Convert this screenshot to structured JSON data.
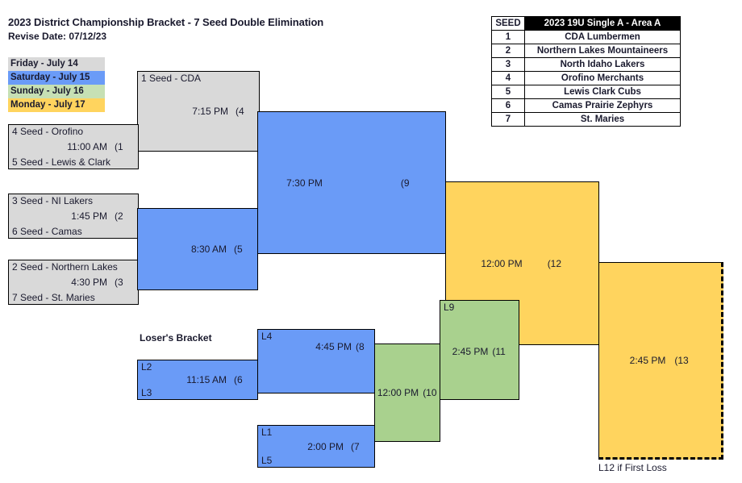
{
  "header": {
    "title": "2023 District Championship Bracket - 7 Seed Double Elimination",
    "revise_date": "Revise Date: 07/12/23"
  },
  "legend": {
    "items": [
      {
        "label": "Friday - July 14",
        "color": "#d9d9d9"
      },
      {
        "label": "Saturday - July 15",
        "color": "#6a9bf7"
      },
      {
        "label": "Sunday - July 16",
        "color": "#a9d18e"
      },
      {
        "label": "Monday - July 17",
        "color": "#ffd45e"
      }
    ]
  },
  "seed_table": {
    "headers": {
      "seed": "SEED",
      "division": "2023 19U Single A - Area A"
    },
    "rows": [
      {
        "seed": "1",
        "team": "CDA Lumbermen"
      },
      {
        "seed": "2",
        "team": "Northern Lakes Mountaineers"
      },
      {
        "seed": "3",
        "team": "North Idaho Lakers"
      },
      {
        "seed": "4",
        "team": "Orofino Merchants"
      },
      {
        "seed": "5",
        "team": "Lewis Clark Cubs"
      },
      {
        "seed": "6",
        "team": "Camas Prairie Zephyrs"
      },
      {
        "seed": "7",
        "team": "St. Maries"
      }
    ]
  },
  "bracket": {
    "winners": {
      "game1": {
        "top": "4 Seed - Orofino",
        "bottom": "5 Seed - Lewis & Clark",
        "time": "11:00 AM",
        "number": "(1"
      },
      "game2": {
        "top": "3 Seed - NI Lakers",
        "bottom": "6 Seed - Camas",
        "time": "1:45 PM",
        "number": "(2"
      },
      "game3": {
        "top": "2 Seed - Northern Lakes",
        "bottom": "7 Seed - St. Maries",
        "time": "4:30 PM",
        "number": "(3"
      },
      "game4": {
        "top": "1 Seed - CDA",
        "bottom": "",
        "time": "7:15 PM",
        "number": "(4"
      },
      "game5": {
        "top": "",
        "bottom": "",
        "time": "8:30 AM",
        "number": "(5"
      },
      "game9": {
        "top": "",
        "bottom": "",
        "time": "7:30 PM",
        "number": "(9"
      },
      "game12": {
        "top": "",
        "bottom": "",
        "time": "12:00 PM",
        "number": "(12"
      },
      "game13": {
        "top": "",
        "bottom": "",
        "time": "2:45 PM",
        "number": "(13"
      }
    },
    "losers": {
      "section_label": "Loser's Bracket",
      "game6": {
        "top": "L2",
        "bottom": "L3",
        "time": "11:15 AM",
        "number": "(6"
      },
      "game7": {
        "top": "L1",
        "bottom": "L5",
        "time": "2:00 PM",
        "number": "(7"
      },
      "game8": {
        "top": "L4",
        "bottom": "",
        "time": "4:45 PM",
        "number": "(8"
      },
      "game10": {
        "top": "",
        "bottom": "",
        "time": "12:00 PM",
        "number": "(10"
      },
      "game11": {
        "top": "L9",
        "bottom": "",
        "time": "2:45 PM",
        "number": "(11"
      }
    },
    "footnote": "L12 if First Loss"
  },
  "colors": {
    "friday_gray": "#d9d9d9",
    "saturday_blue": "#6a9bf7",
    "sunday_green": "#a9d18e",
    "monday_yellow": "#ffd45e",
    "border": "#000000"
  }
}
